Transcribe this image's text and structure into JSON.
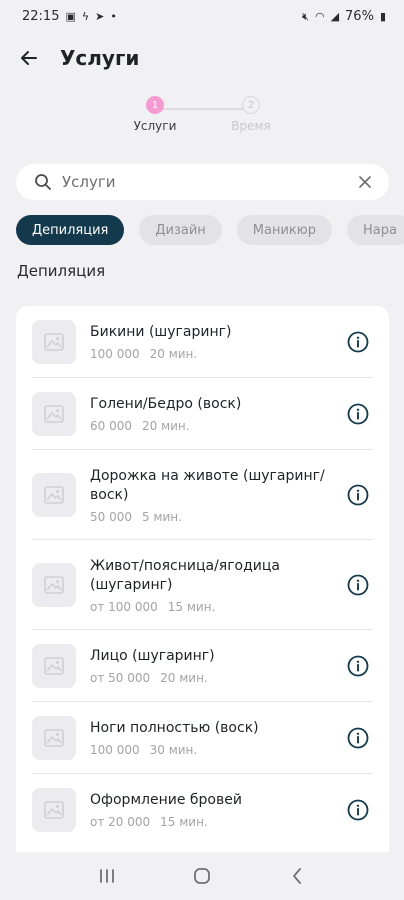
{
  "status_bar": {
    "time": "22:15",
    "battery": "76%"
  },
  "header": {
    "title": "Услуги"
  },
  "stepper": {
    "steps": [
      {
        "number": "1",
        "label": "Услуги"
      },
      {
        "number": "2",
        "label": "Время"
      }
    ]
  },
  "search": {
    "placeholder": "Услуги",
    "value": ""
  },
  "chips": [
    "Депиляция",
    "Дизайн",
    "Маникюр",
    "Нара"
  ],
  "section": {
    "title": "Депиляция"
  },
  "services": [
    {
      "title": "Бикини (шугаринг)",
      "price": "100 000",
      "duration": "20 мин."
    },
    {
      "title": "Голени/Бедро (воск)",
      "price": "60 000",
      "duration": "20 мин."
    },
    {
      "title": "Дорожка на животе (шугаринг/ воск)",
      "price": "50 000",
      "duration": "5 мин."
    },
    {
      "title": "Живот/поясница/ягодица (шугаринг)",
      "price": "от 100 000",
      "duration": "15 мин."
    },
    {
      "title": "Лицо (шугаринг)",
      "price": "от 50 000",
      "duration": "20 мин."
    },
    {
      "title": "Ноги полностью (воск)",
      "price": "100 000",
      "duration": "30 мин."
    },
    {
      "title": "Оформление бровей",
      "price": "от 20 000",
      "duration": "15 мин."
    }
  ],
  "colors": {
    "accent": "#14394d",
    "step_active": "#f59bd2",
    "background": "#f1f1f4"
  }
}
